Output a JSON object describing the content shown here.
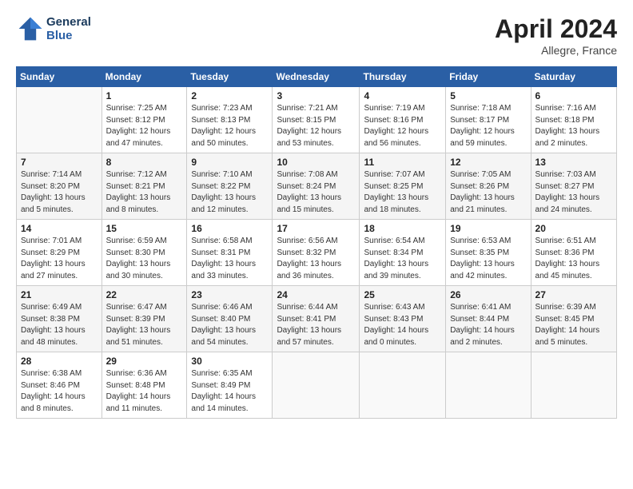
{
  "header": {
    "logo_line1": "General",
    "logo_line2": "Blue",
    "title": "April 2024",
    "location": "Allegre, France"
  },
  "weekdays": [
    "Sunday",
    "Monday",
    "Tuesday",
    "Wednesday",
    "Thursday",
    "Friday",
    "Saturday"
  ],
  "weeks": [
    [
      {
        "day": "",
        "info": ""
      },
      {
        "day": "1",
        "info": "Sunrise: 7:25 AM\nSunset: 8:12 PM\nDaylight: 12 hours\nand 47 minutes."
      },
      {
        "day": "2",
        "info": "Sunrise: 7:23 AM\nSunset: 8:13 PM\nDaylight: 12 hours\nand 50 minutes."
      },
      {
        "day": "3",
        "info": "Sunrise: 7:21 AM\nSunset: 8:15 PM\nDaylight: 12 hours\nand 53 minutes."
      },
      {
        "day": "4",
        "info": "Sunrise: 7:19 AM\nSunset: 8:16 PM\nDaylight: 12 hours\nand 56 minutes."
      },
      {
        "day": "5",
        "info": "Sunrise: 7:18 AM\nSunset: 8:17 PM\nDaylight: 12 hours\nand 59 minutes."
      },
      {
        "day": "6",
        "info": "Sunrise: 7:16 AM\nSunset: 8:18 PM\nDaylight: 13 hours\nand 2 minutes."
      }
    ],
    [
      {
        "day": "7",
        "info": "Sunrise: 7:14 AM\nSunset: 8:20 PM\nDaylight: 13 hours\nand 5 minutes."
      },
      {
        "day": "8",
        "info": "Sunrise: 7:12 AM\nSunset: 8:21 PM\nDaylight: 13 hours\nand 8 minutes."
      },
      {
        "day": "9",
        "info": "Sunrise: 7:10 AM\nSunset: 8:22 PM\nDaylight: 13 hours\nand 12 minutes."
      },
      {
        "day": "10",
        "info": "Sunrise: 7:08 AM\nSunset: 8:24 PM\nDaylight: 13 hours\nand 15 minutes."
      },
      {
        "day": "11",
        "info": "Sunrise: 7:07 AM\nSunset: 8:25 PM\nDaylight: 13 hours\nand 18 minutes."
      },
      {
        "day": "12",
        "info": "Sunrise: 7:05 AM\nSunset: 8:26 PM\nDaylight: 13 hours\nand 21 minutes."
      },
      {
        "day": "13",
        "info": "Sunrise: 7:03 AM\nSunset: 8:27 PM\nDaylight: 13 hours\nand 24 minutes."
      }
    ],
    [
      {
        "day": "14",
        "info": "Sunrise: 7:01 AM\nSunset: 8:29 PM\nDaylight: 13 hours\nand 27 minutes."
      },
      {
        "day": "15",
        "info": "Sunrise: 6:59 AM\nSunset: 8:30 PM\nDaylight: 13 hours\nand 30 minutes."
      },
      {
        "day": "16",
        "info": "Sunrise: 6:58 AM\nSunset: 8:31 PM\nDaylight: 13 hours\nand 33 minutes."
      },
      {
        "day": "17",
        "info": "Sunrise: 6:56 AM\nSunset: 8:32 PM\nDaylight: 13 hours\nand 36 minutes."
      },
      {
        "day": "18",
        "info": "Sunrise: 6:54 AM\nSunset: 8:34 PM\nDaylight: 13 hours\nand 39 minutes."
      },
      {
        "day": "19",
        "info": "Sunrise: 6:53 AM\nSunset: 8:35 PM\nDaylight: 13 hours\nand 42 minutes."
      },
      {
        "day": "20",
        "info": "Sunrise: 6:51 AM\nSunset: 8:36 PM\nDaylight: 13 hours\nand 45 minutes."
      }
    ],
    [
      {
        "day": "21",
        "info": "Sunrise: 6:49 AM\nSunset: 8:38 PM\nDaylight: 13 hours\nand 48 minutes."
      },
      {
        "day": "22",
        "info": "Sunrise: 6:47 AM\nSunset: 8:39 PM\nDaylight: 13 hours\nand 51 minutes."
      },
      {
        "day": "23",
        "info": "Sunrise: 6:46 AM\nSunset: 8:40 PM\nDaylight: 13 hours\nand 54 minutes."
      },
      {
        "day": "24",
        "info": "Sunrise: 6:44 AM\nSunset: 8:41 PM\nDaylight: 13 hours\nand 57 minutes."
      },
      {
        "day": "25",
        "info": "Sunrise: 6:43 AM\nSunset: 8:43 PM\nDaylight: 14 hours\nand 0 minutes."
      },
      {
        "day": "26",
        "info": "Sunrise: 6:41 AM\nSunset: 8:44 PM\nDaylight: 14 hours\nand 2 minutes."
      },
      {
        "day": "27",
        "info": "Sunrise: 6:39 AM\nSunset: 8:45 PM\nDaylight: 14 hours\nand 5 minutes."
      }
    ],
    [
      {
        "day": "28",
        "info": "Sunrise: 6:38 AM\nSunset: 8:46 PM\nDaylight: 14 hours\nand 8 minutes."
      },
      {
        "day": "29",
        "info": "Sunrise: 6:36 AM\nSunset: 8:48 PM\nDaylight: 14 hours\nand 11 minutes."
      },
      {
        "day": "30",
        "info": "Sunrise: 6:35 AM\nSunset: 8:49 PM\nDaylight: 14 hours\nand 14 minutes."
      },
      {
        "day": "",
        "info": ""
      },
      {
        "day": "",
        "info": ""
      },
      {
        "day": "",
        "info": ""
      },
      {
        "day": "",
        "info": ""
      }
    ]
  ]
}
